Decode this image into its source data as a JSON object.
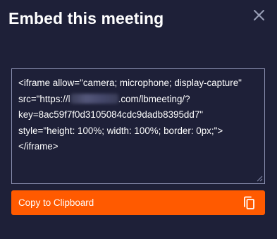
{
  "dialog": {
    "title": "Embed this meeting",
    "close_icon": "close-icon"
  },
  "embed_code": {
    "line1": "<iframe allow=\"camera; microphone; display-capture\"",
    "line2_prefix": "src=\"https://l",
    "line2_suffix": ".com/lbmeeting/?",
    "line3": "key=8ac59f7f0d3105084cdc9dadb8395dd7\"",
    "line4": "style=\"height: 100%; width: 100%; border: 0px;\">",
    "line5": "</iframe>"
  },
  "copy_button": {
    "label": "Copy to Clipboard",
    "icon": "copy-icon"
  },
  "colors": {
    "background": "#1e2038",
    "accent": "#ff5a00",
    "border": "#8a8fb0"
  }
}
